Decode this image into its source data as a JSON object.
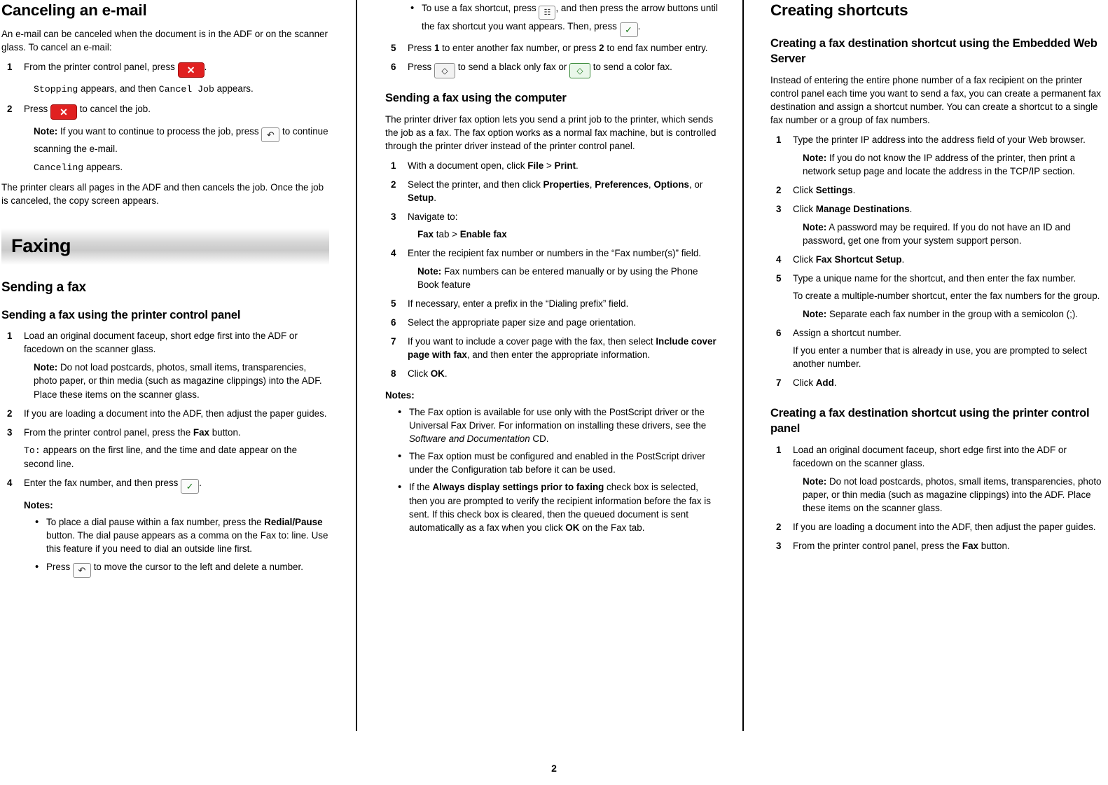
{
  "page": {
    "number": "2"
  },
  "col1": {
    "title": "Canceling an e-mail",
    "intro": "An e-mail can be canceled when the document is in the ADF or on the scanner glass. To cancel an e-mail:",
    "steps": [
      {
        "num": "1",
        "text_before": "From the printer control panel, press",
        "icon": "cancel-x-key",
        "text_after": ".",
        "mono_line_pre": "Stopping",
        "mono_line_mid": " appears, and then ",
        "mono_line_key": "Cancel Job",
        "mono_line_post": " appears."
      },
      {
        "num": "2",
        "text_before": "Press",
        "icon": "cancel-x-key",
        "text_after": "to cancel the job.",
        "note_label": "Note:",
        "note_text_before": "If you want to continue to process the job, press",
        "note_icon": "back-arrow-key",
        "note_text_after": "to continue scanning the e-mail.",
        "mono_after": "Canceling",
        "mono_after_post": " appears."
      }
    ],
    "closing": "The printer clears all pages in the ADF and then cancels the job. Once the job is canceled, the copy screen appears.",
    "banner": "Faxing",
    "section_sending_fax": "Sending a fax",
    "sub_control_panel": "Sending a fax using the printer control panel",
    "cp_steps": [
      {
        "num": "1",
        "text": "Load an original document faceup, short edge first into the ADF or facedown on the scanner glass.",
        "note_label": "Note:",
        "note_text": "Do not load postcards, photos, small items, transparencies, photo paper, or thin media (such as magazine clippings) into the ADF. Place these items on the scanner glass."
      },
      {
        "num": "2",
        "text": "If you are loading a document into the ADF, then adjust the paper guides."
      },
      {
        "num": "3",
        "text_pre": "From the printer control panel, press the ",
        "bold": "Fax",
        "text_post": " button.",
        "mono": "To:",
        "sub": " appears on the first line, and the time and date appear on the second line."
      },
      {
        "num": "4",
        "text_pre": "Enter the fax number, and then press",
        "icon": "check-key",
        "text_post": ".",
        "notes_label": "Notes:",
        "bullets": [
          {
            "pre": "To place a dial pause within a fax number, press the ",
            "bold": "Redial/Pause",
            "post": " button. The dial pause appears as a comma on the Fax to: line. Use this feature if you need to dial an outside line first."
          },
          {
            "pre": "Press",
            "icon": "back-arrow-key",
            "post": "to move the cursor to the left and delete a number."
          }
        ]
      }
    ]
  },
  "col2": {
    "top_bullet": {
      "pre": "To use a fax shortcut, press",
      "icon": "keypad-key",
      "mid": ", and then press the arrow buttons until the fax shortcut you want appears. Then, press",
      "icon2": "check-key",
      "post": "."
    },
    "steps": [
      {
        "num": "5",
        "pre": "Press ",
        "b1": "1",
        "mid": " to enter another fax number, or press ",
        "b2": "2",
        "post": " to end fax number entry."
      },
      {
        "num": "6",
        "pre": "Press",
        "icon": "start-black-key",
        "mid": "to send a black only fax or",
        "icon2": "start-color-key",
        "post": "to send a color fax."
      }
    ],
    "sub_computer": "Sending a fax using the computer",
    "computer_intro": "The printer driver fax option lets you send a print job to the printer, which sends the job as a fax. The fax option works as a normal fax machine, but is controlled through the printer driver instead of the printer control panel.",
    "comp_steps": [
      {
        "num": "1",
        "pre": "With a document open, click ",
        "b1": "File",
        "mid": " > ",
        "b2": "Print",
        "post": "."
      },
      {
        "num": "2",
        "pre": "Select the printer, and then click ",
        "b1": "Properties",
        "mid": ", ",
        "b2": "Preferences",
        "mid2": ", ",
        "b3": "Options",
        "mid3": ", or ",
        "b4": "Setup",
        "post": "."
      },
      {
        "num": "3",
        "pre": "Navigate to:",
        "path_b1": "Fax",
        "path_mid": " tab > ",
        "path_b2": "Enable fax"
      },
      {
        "num": "4",
        "pre": "Enter the recipient fax number or numbers in the “Fax number(s)” field.",
        "note_label": "Note:",
        "note_text": "Fax numbers can be entered manually or by using the Phone Book feature"
      },
      {
        "num": "5",
        "pre": "If necessary, enter a prefix in the “Dialing prefix” field."
      },
      {
        "num": "6",
        "pre": "Select the appropriate paper size and page orientation."
      },
      {
        "num": "7",
        "pre": "If you want to include a cover page with the fax, then select ",
        "b1": "Include cover page with fax",
        "post": ", and then enter the appropriate information."
      },
      {
        "num": "8",
        "pre": "Click ",
        "b1": "OK",
        "post": "."
      }
    ],
    "notes_label": "Notes:",
    "notes_bullets": [
      {
        "pre": "The Fax option is available for use only with the PostScript driver or the Universal Fax Driver. For information on installing these drivers, see the ",
        "italic": "Software and Documentation",
        "post": " CD."
      },
      {
        "pre": "The Fax option must be configured and enabled in the PostScript driver under the Configuration tab before it can be used."
      },
      {
        "pre": "If the ",
        "b1": "Always display settings prior to faxing",
        "mid": " check box is selected, then you are prompted to verify the recipient information before the fax is sent. If this check box is cleared, then the queued document is sent automatically as a fax when you click ",
        "b2": "OK",
        "post": " on the Fax tab."
      }
    ]
  },
  "col3": {
    "title": "Creating shortcuts",
    "sub_ews": "Creating a fax destination shortcut using the Embedded Web Server",
    "ews_intro": "Instead of entering the entire phone number of a fax recipient on the printer control panel each time you want to send a fax, you can create a permanent fax destination and assign a shortcut number. You can create a shortcut to a single fax number or a group of fax numbers.",
    "ews_steps": [
      {
        "num": "1",
        "pre": "Type the printer IP address into the address field of your Web browser.",
        "note_label": "Note:",
        "note_text": "If you do not know the IP address of the printer, then print a network setup page and locate the address in the TCP/IP section."
      },
      {
        "num": "2",
        "pre": "Click ",
        "b1": "Settings",
        "post": "."
      },
      {
        "num": "3",
        "pre": "Click ",
        "b1": "Manage Destinations",
        "post": ".",
        "note_label": "Note:",
        "note_text": "A password may be required. If you do not have an ID and password, get one from your system support person."
      },
      {
        "num": "4",
        "pre": "Click ",
        "b1": "Fax Shortcut Setup",
        "post": "."
      },
      {
        "num": "5",
        "pre": "Type a unique name for the shortcut, and then enter the fax number.",
        "sub": "To create a multiple-number shortcut, enter the fax numbers for the group.",
        "note_label": "Note:",
        "note_text": "Separate each fax number in the group with a semicolon (;)."
      },
      {
        "num": "6",
        "pre": "Assign a shortcut number.",
        "sub": "If you enter a number that is already in use, you are prompted to select another number."
      },
      {
        "num": "7",
        "pre": "Click ",
        "b1": "Add",
        "post": "."
      }
    ],
    "sub_cp": "Creating a fax destination shortcut using the printer control panel",
    "cp_steps": [
      {
        "num": "1",
        "pre": "Load an original document faceup, short edge first into the ADF or facedown on the scanner glass.",
        "note_label": "Note:",
        "note_text": "Do not load postcards, photos, small items, transparencies, photo paper, or thin media (such as magazine clippings) into the ADF. Place these items on the scanner glass."
      },
      {
        "num": "2",
        "pre": "If you are loading a document into the ADF, then adjust the paper guides."
      },
      {
        "num": "3",
        "pre": "From the printer control panel, press the ",
        "b1": "Fax",
        "post": " button."
      }
    ]
  },
  "icons": {
    "cancel_x": "✕",
    "back_arrow": "↶",
    "check": "✓",
    "keypad": "☷",
    "start_black": "◇",
    "start_color": "◇"
  }
}
